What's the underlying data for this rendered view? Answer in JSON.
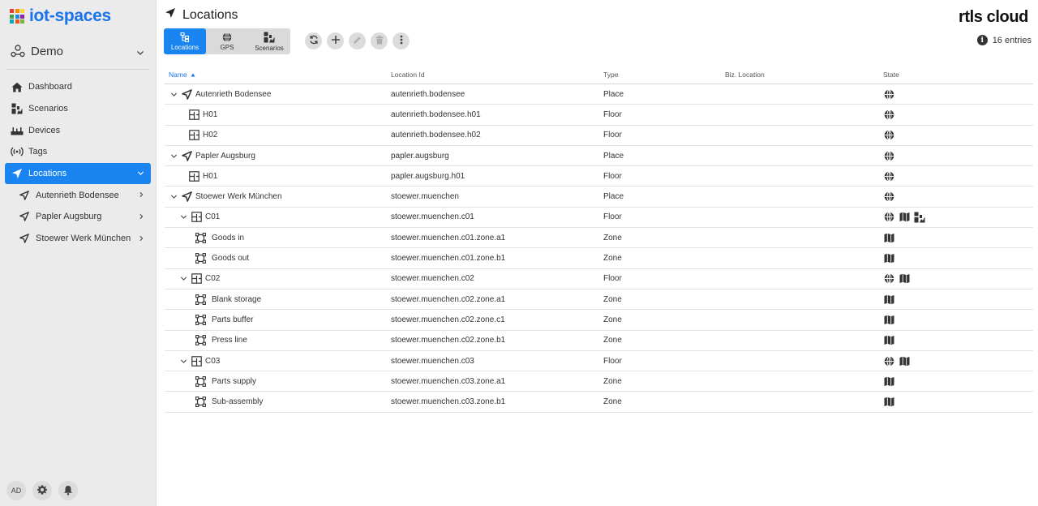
{
  "brand": {
    "name": "iot-spaces",
    "grid_colors": [
      "#e53935",
      "#fb8c00",
      "#fdd835",
      "#43a047",
      "#1e88e5",
      "#8e24aa",
      "#00acc1",
      "#f4511e",
      "#7cb342"
    ]
  },
  "tenant": {
    "name": "Demo"
  },
  "nav": {
    "items": [
      {
        "label": "Dashboard",
        "icon": "home-icon"
      },
      {
        "label": "Scenarios",
        "icon": "scenarios-icon"
      },
      {
        "label": "Devices",
        "icon": "devices-icon"
      },
      {
        "label": "Tags",
        "icon": "tags-icon"
      },
      {
        "label": "Locations",
        "icon": "location-arrow-icon",
        "active": true
      }
    ],
    "sub_items": [
      {
        "label": "Autenrieth Bodensee"
      },
      {
        "label": "Papler Augsburg"
      },
      {
        "label": "Stoewer Werk München"
      }
    ]
  },
  "footer": {
    "avatar": "AD"
  },
  "header": {
    "title": "Locations",
    "logo": "rtls cloud",
    "entries": "16 entries"
  },
  "view_tabs": [
    {
      "label": "Locations",
      "icon": "tree-icon",
      "active": true
    },
    {
      "label": "GPS",
      "icon": "globe-icon"
    },
    {
      "label": "Scenarios",
      "icon": "scenarios-icon"
    }
  ],
  "table": {
    "columns": [
      "Name",
      "Location Id",
      "Type",
      "Biz. Location",
      "State"
    ],
    "rows": [
      {
        "level": 0,
        "expander": true,
        "kind": "place",
        "name": "Autenrieth Bodensee",
        "id": "autenrieth.bodensee",
        "type": "Place",
        "biz": "",
        "state": [
          "globe"
        ]
      },
      {
        "level": 1,
        "expander": false,
        "kind": "floor",
        "name": "H01",
        "id": "autenrieth.bodensee.h01",
        "type": "Floor",
        "biz": "",
        "state": [
          "globe"
        ]
      },
      {
        "level": 1,
        "expander": false,
        "kind": "floor",
        "name": "H02",
        "id": "autenrieth.bodensee.h02",
        "type": "Floor",
        "biz": "",
        "state": [
          "globe"
        ]
      },
      {
        "level": 0,
        "expander": true,
        "kind": "place",
        "name": "Papler Augsburg",
        "id": "papler.augsburg",
        "type": "Place",
        "biz": "",
        "state": [
          "globe"
        ]
      },
      {
        "level": 1,
        "expander": false,
        "kind": "floor",
        "name": "H01",
        "id": "papler.augsburg.h01",
        "type": "Floor",
        "biz": "",
        "state": [
          "globe"
        ]
      },
      {
        "level": 0,
        "expander": true,
        "kind": "place",
        "name": "Stoewer Werk München",
        "id": "stoewer.muenchen",
        "type": "Place",
        "biz": "",
        "state": [
          "globe"
        ]
      },
      {
        "level": 1,
        "expander": true,
        "kind": "floor",
        "name": "C01",
        "id": "stoewer.muenchen.c01",
        "type": "Floor",
        "biz": "",
        "state": [
          "globe",
          "map",
          "scenario"
        ]
      },
      {
        "level": 2,
        "expander": false,
        "kind": "zone",
        "name": "Goods in",
        "id": "stoewer.muenchen.c01.zone.a1",
        "type": "Zone",
        "biz": "",
        "state": [
          "map"
        ]
      },
      {
        "level": 2,
        "expander": false,
        "kind": "zone",
        "name": "Goods out",
        "id": "stoewer.muenchen.c01.zone.b1",
        "type": "Zone",
        "biz": "",
        "state": [
          "map"
        ]
      },
      {
        "level": 1,
        "expander": true,
        "kind": "floor",
        "name": "C02",
        "id": "stoewer.muenchen.c02",
        "type": "Floor",
        "biz": "",
        "state": [
          "globe",
          "map"
        ]
      },
      {
        "level": 2,
        "expander": false,
        "kind": "zone",
        "name": "Blank storage",
        "id": "stoewer.muenchen.c02.zone.a1",
        "type": "Zone",
        "biz": "",
        "state": [
          "map"
        ]
      },
      {
        "level": 2,
        "expander": false,
        "kind": "zone",
        "name": "Parts buffer",
        "id": "stoewer.muenchen.c02.zone.c1",
        "type": "Zone",
        "biz": "",
        "state": [
          "map"
        ]
      },
      {
        "level": 2,
        "expander": false,
        "kind": "zone",
        "name": "Press line",
        "id": "stoewer.muenchen.c02.zone.b1",
        "type": "Zone",
        "biz": "",
        "state": [
          "map"
        ]
      },
      {
        "level": 1,
        "expander": true,
        "kind": "floor",
        "name": "C03",
        "id": "stoewer.muenchen.c03",
        "type": "Floor",
        "biz": "",
        "state": [
          "globe",
          "map"
        ]
      },
      {
        "level": 2,
        "expander": false,
        "kind": "zone",
        "name": "Parts supply",
        "id": "stoewer.muenchen.c03.zone.a1",
        "type": "Zone",
        "biz": "",
        "state": [
          "map"
        ]
      },
      {
        "level": 2,
        "expander": false,
        "kind": "zone",
        "name": "Sub-assembly",
        "id": "stoewer.muenchen.c03.zone.b1",
        "type": "Zone",
        "biz": "",
        "state": [
          "map"
        ]
      }
    ]
  },
  "colors": {
    "accent": "#1a84f0",
    "brand": "#1a73e8",
    "sidebar": "#ebebeb"
  }
}
